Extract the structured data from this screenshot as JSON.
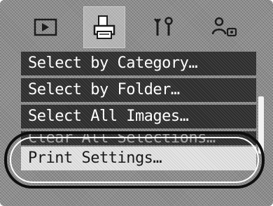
{
  "tabs": [
    {
      "icon": "play-icon",
      "selected": false
    },
    {
      "icon": "print-icon",
      "selected": true
    },
    {
      "icon": "tools-icon",
      "selected": false
    },
    {
      "icon": "user-settings-icon",
      "selected": false
    }
  ],
  "menu": {
    "items": [
      {
        "label": "Select by Category…",
        "selected": false
      },
      {
        "label": "Select by Folder…",
        "selected": false
      },
      {
        "label": "Select All Images…",
        "selected": false
      },
      {
        "label": "Clear All Selections…",
        "selected": false
      },
      {
        "label": "Print Settings…",
        "selected": true
      }
    ]
  },
  "colors": {
    "item_background": "#2c2c2c",
    "selected_background": "#e6e6e6",
    "text": "#ffffff",
    "selected_text": "#1a1a1a",
    "highlight_ring": "#0e0e0e"
  }
}
